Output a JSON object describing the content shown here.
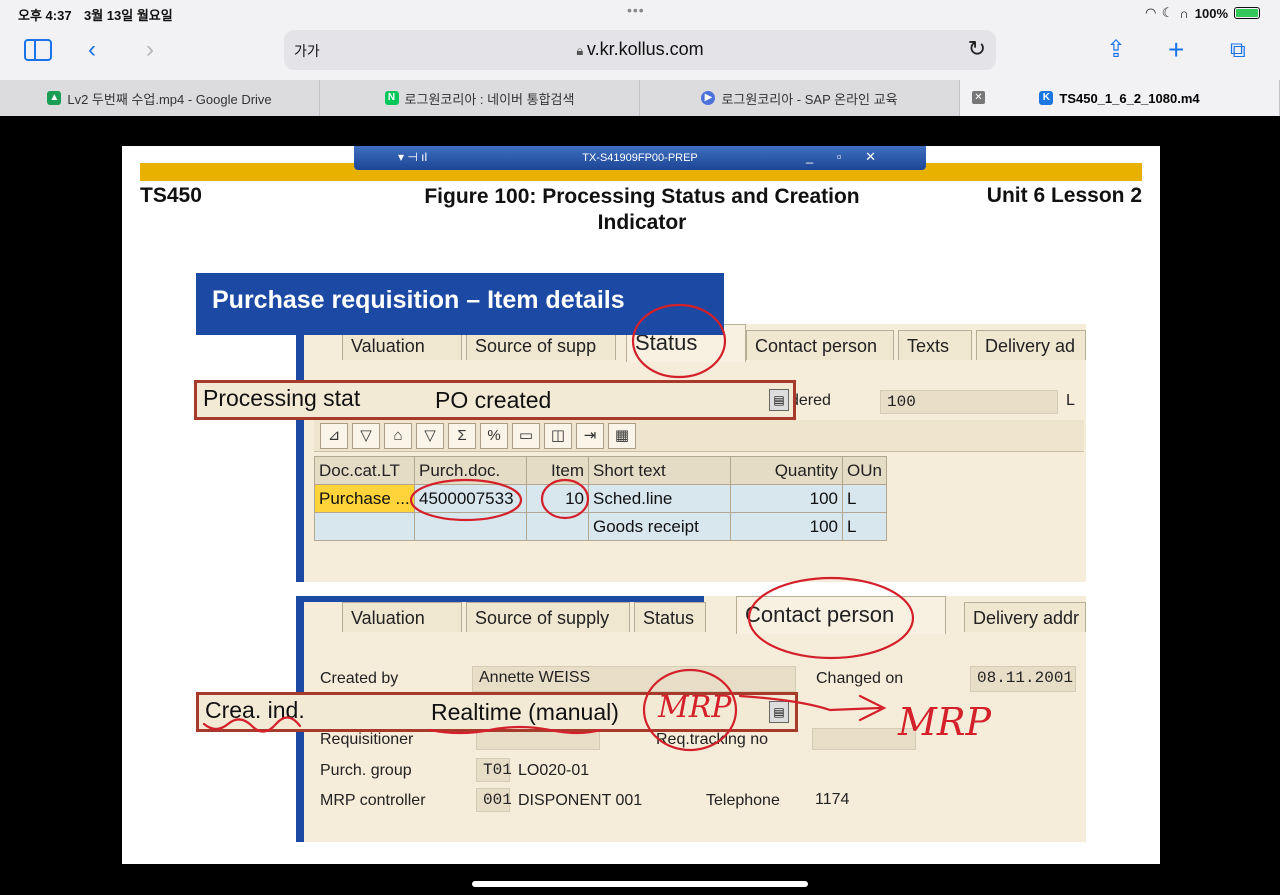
{
  "status_bar": {
    "time": "오후 4:37",
    "date": "3월 13일 월요일",
    "dots": "•••",
    "battery": "100%"
  },
  "browser": {
    "text_size_label": "가가",
    "url": "v.kr.kollus.com",
    "tabs": [
      {
        "label": "Lv2 두번째 수업.mp4 - Google Drive",
        "color": "#1a9d55"
      },
      {
        "label": "로그원코리아 : 네이버 통합검색",
        "color": "#03c75a",
        "glyph": "N"
      },
      {
        "label": "로그원코리아 - SAP 온라인 교육",
        "color": "#4a72d9",
        "glyph": "▶"
      },
      {
        "label": "TS450_1_6_2_1080.m4",
        "color": "#1c76e0",
        "glyph": "K"
      }
    ]
  },
  "slide": {
    "citrix_title": "TX-S41909FP00-PREP",
    "course": "TS450",
    "figure_title_line1": "Figure 100: Processing Status and Creation",
    "figure_title_line2": "Indicator",
    "unit": "Unit 6 Lesson 2",
    "screen_title": "Purchase requisition – Item details",
    "panel1": {
      "tabs": [
        "Valuation",
        "Source of supp",
        "Status",
        "Contact person",
        "Texts",
        "Delivery ad"
      ],
      "processing_label": "Processing stat",
      "processing_value": "PO created",
      "ordered_label": "dered",
      "ordered_value": "100",
      "ordered_unit": "L",
      "toolbar_icons": [
        "⊿",
        "▽",
        "⌂",
        "▽",
        "Σ",
        "%",
        "▭",
        "◫",
        "⇥",
        "▦"
      ],
      "table": {
        "headers": [
          "Doc.cat.LT",
          "Purch.doc.",
          "Item",
          "Short text",
          "Quantity",
          "OUn"
        ],
        "rows": [
          [
            "Purchase ...",
            "4500007533",
            "10",
            "Sched.line",
            "100",
            "L"
          ],
          [
            "",
            "",
            "",
            "Goods receipt",
            "100",
            "L"
          ]
        ]
      }
    },
    "panel2": {
      "tabs": [
        "Valuation",
        "Source of supply",
        "Status",
        "Contact person",
        "Delivery addr"
      ],
      "created_by_label": "Created by",
      "created_by_value": "Annette WEISS",
      "changed_on_label": "Changed on",
      "changed_on_value": "08.11.2001",
      "crea_label": "Crea. ind.",
      "crea_value": "Realtime (manual)",
      "requisitioner_label": "Requisitioner",
      "req_tracking_label": "Req.tracking no",
      "purch_group_label": "Purch. group",
      "purch_group_code": "T01",
      "purch_group_value": "LO020-01",
      "mrp_controller_label": "MRP controller",
      "mrp_controller_code": "001",
      "mrp_controller_value": "DISPONENT 001",
      "telephone_label": "Telephone",
      "telephone_value": "1174"
    },
    "annotation_text": "MRP"
  },
  "colors": {
    "sap_blue": "#1b49a3",
    "gold": "#e8b100",
    "annotation_red": "#d4202a",
    "box_red": "#a83a2c"
  }
}
